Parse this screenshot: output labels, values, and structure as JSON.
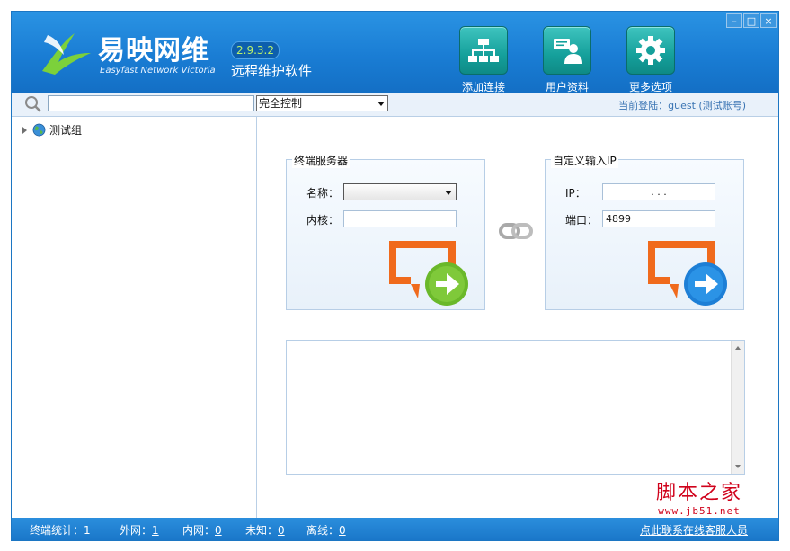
{
  "window": {
    "controls": {
      "minimize": "–",
      "maximize": "□",
      "close": "×"
    }
  },
  "brand": {
    "name_cn": "易映网维",
    "name_en": "Easyfast Network Victoria",
    "version": "2.9.3.2",
    "subtitle": "远程维护软件"
  },
  "toolbar": [
    {
      "label": "添加连接",
      "icon": "network-icon"
    },
    {
      "label": "用户资料",
      "icon": "user-profile-icon"
    },
    {
      "label": "更多选项",
      "icon": "gear-icon"
    }
  ],
  "searchbar": {
    "search_placeholder": "",
    "mode": "完全控制",
    "login_status": "当前登陆：guest (测试账号)"
  },
  "tree": {
    "items": [
      {
        "label": "测试组",
        "icon": "globe-icon"
      }
    ]
  },
  "terminal_server": {
    "title": "终端服务器",
    "name_label": "名称：",
    "name_value": "",
    "core_label": "内核：",
    "core_value": ""
  },
  "custom_ip": {
    "title": "自定义输入IP",
    "ip_label": "IP：",
    "ip_value": ".       .       .",
    "port_label": "端口：",
    "port_value": "4899"
  },
  "log": {
    "text": ""
  },
  "statusbar": {
    "terminal_label": "终端统计：",
    "terminal_count": "1",
    "external_label": "外网：",
    "external_count": "1",
    "internal_label": "内网：",
    "internal_count": "0",
    "unknown_label": "未知：",
    "unknown_count": "0",
    "offline_label": "离线：",
    "offline_count": "0",
    "support_link": "点此联系在线客服人员"
  },
  "watermark": {
    "cn": "脚本之家",
    "url": "www.jb51.net"
  },
  "colors": {
    "header": "#1a7dd4",
    "toolbar_tile": "#15a09b",
    "connect_orange": "#f06a1c",
    "connect_green": "#6ab82a",
    "connect_blue": "#1d7fd6",
    "version_text": "#b9f06a",
    "watermark": "#d0021b"
  }
}
